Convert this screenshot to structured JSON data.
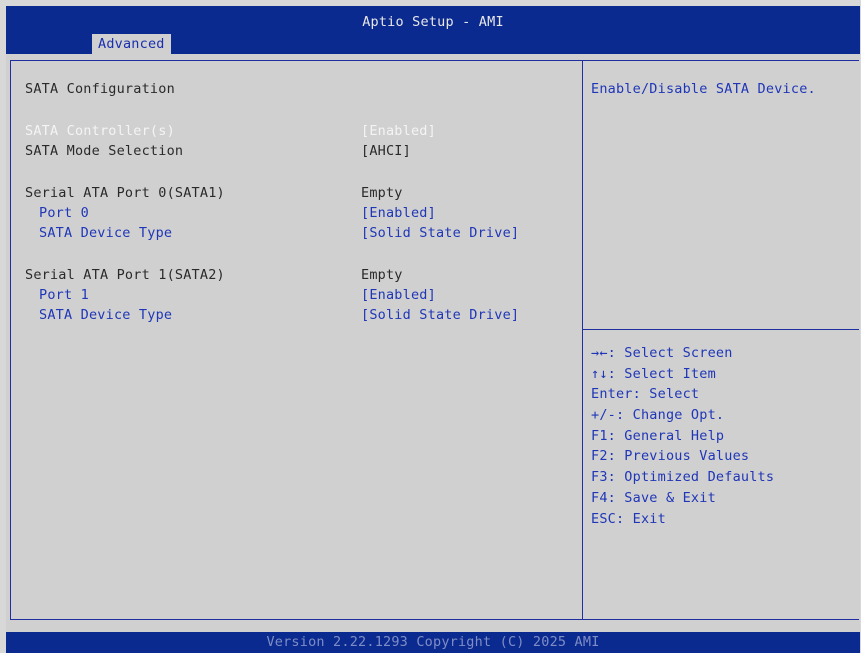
{
  "header": {
    "title": "Aptio Setup - AMI",
    "active_tab": "Advanced"
  },
  "main": {
    "section_title": "SATA Configuration",
    "items": [
      {
        "label": "SATA Controller(s)",
        "value": "[Enabled]",
        "state": "selected"
      },
      {
        "label": "SATA Mode Selection",
        "value": "[AHCI]",
        "state": "static"
      },
      {
        "label": "Serial ATA Port 0(SATA1)",
        "value": "Empty",
        "state": "static"
      },
      {
        "label": "Port 0",
        "value": "[Enabled]",
        "state": "option"
      },
      {
        "label": "SATA Device Type",
        "value": "[Solid State Drive]",
        "state": "option"
      },
      {
        "label": "Serial ATA Port 1(SATA2)",
        "value": "Empty",
        "state": "static"
      },
      {
        "label": "Port 1",
        "value": "[Enabled]",
        "state": "option"
      },
      {
        "label": "SATA Device Type",
        "value": "[Solid State Drive]",
        "state": "option"
      }
    ]
  },
  "help": {
    "description": "Enable/Disable SATA Device.",
    "keys": [
      "→←: Select Screen",
      "↑↓: Select Item",
      "Enter: Select",
      "+/-: Change Opt.",
      "F1: General Help",
      "F2: Previous Values",
      "F3: Optimized Defaults",
      "F4: Save & Exit",
      "ESC: Exit"
    ]
  },
  "footer": {
    "text": "Version 2.22.1293 Copyright (C) 2025 AMI"
  },
  "colors": {
    "header_bg": "#0b2a8f",
    "panel_bg": "#d0d0d0",
    "option_text": "#1f36b8",
    "selected_text": "#f4f4f4",
    "static_text": "#2a2a2a",
    "footer_text": "#7f8dc6"
  }
}
